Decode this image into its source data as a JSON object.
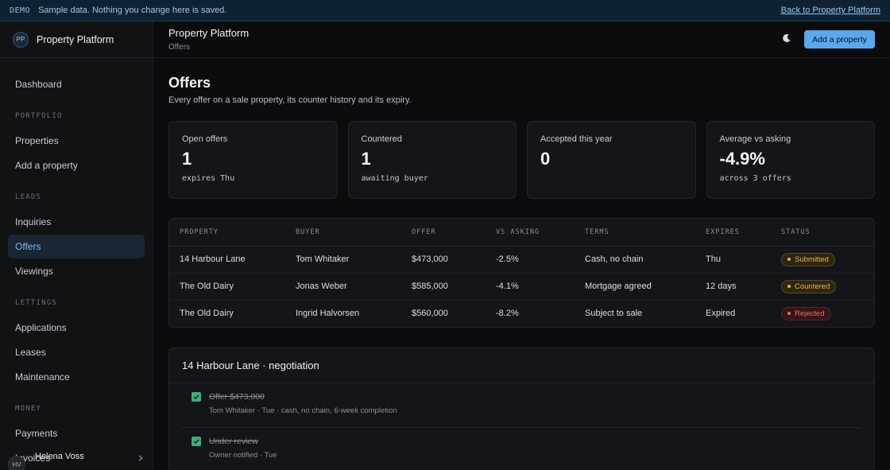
{
  "banner": {
    "tag": "DEMO",
    "message": "Sample data. Nothing you change here is saved.",
    "back_link": "Back to Property Platform"
  },
  "sidebar": {
    "logo_initials": "PP",
    "brand": "Property Platform",
    "dashboard": "Dashboard",
    "sections": [
      {
        "title": "PORTFOLIO",
        "items": [
          "Properties",
          "Add a property"
        ]
      },
      {
        "title": "LEADS",
        "items": [
          "Inquiries",
          "Offers",
          "Viewings"
        ]
      },
      {
        "title": "LETTINGS",
        "items": [
          "Applications",
          "Leases",
          "Maintenance"
        ]
      },
      {
        "title": "MONEY",
        "items": [
          "Payments",
          "Invoices"
        ]
      }
    ],
    "active_item": "Offers",
    "user": {
      "initials": "HV",
      "name": "Helena Voss"
    }
  },
  "header": {
    "title": "Property Platform",
    "subtitle": "Offers",
    "theme_icon": "moon-icon",
    "add_button": "Add a property"
  },
  "main": {
    "title": "Offers",
    "subtitle": "Every offer on a sale property, its counter history and its expiry.",
    "stats": [
      {
        "label": "Open offers",
        "value": "1",
        "note": "expires Thu"
      },
      {
        "label": "Countered",
        "value": "1",
        "note": "awaiting buyer"
      },
      {
        "label": "Accepted this year",
        "value": "0",
        "note": ""
      },
      {
        "label": "Average vs asking",
        "value": "-4.9%",
        "note": "across 3 offers"
      }
    ],
    "table": {
      "columns": [
        "PROPERTY",
        "BUYER",
        "OFFER",
        "VS ASKING",
        "TERMS",
        "EXPIRES",
        "STATUS"
      ],
      "rows": [
        {
          "property": "14 Harbour Lane",
          "buyer": "Tom Whitaker",
          "offer": "$473,000",
          "vs_asking": "-2.5%",
          "terms": "Cash, no chain",
          "expires": "Thu",
          "status": "Submitted",
          "status_kind": "sub"
        },
        {
          "property": "The Old Dairy",
          "buyer": "Jonas Weber",
          "offer": "$585,000",
          "vs_asking": "-4.1%",
          "terms": "Mortgage agreed",
          "expires": "12 days",
          "status": "Countered",
          "status_kind": "cnt"
        },
        {
          "property": "The Old Dairy",
          "buyer": "Ingrid Halvorsen",
          "offer": "$560,000",
          "vs_asking": "-8.2%",
          "terms": "Subject to sale",
          "expires": "Expired",
          "status": "Rejected",
          "status_kind": "rej"
        }
      ]
    },
    "negotiation": {
      "title": "14 Harbour Lane · negotiation",
      "steps": [
        {
          "title": "Offer $473,000",
          "detail": "Tom Whitaker · Tue · cash, no chain, 6-week completion"
        },
        {
          "title": "Under review",
          "detail": "Owner notified · Tue"
        }
      ]
    }
  },
  "colors": {
    "accent": "#5aa8ee",
    "success": "#3bb07a",
    "warning": "#e6b34a",
    "danger": "#ef6a6a"
  }
}
